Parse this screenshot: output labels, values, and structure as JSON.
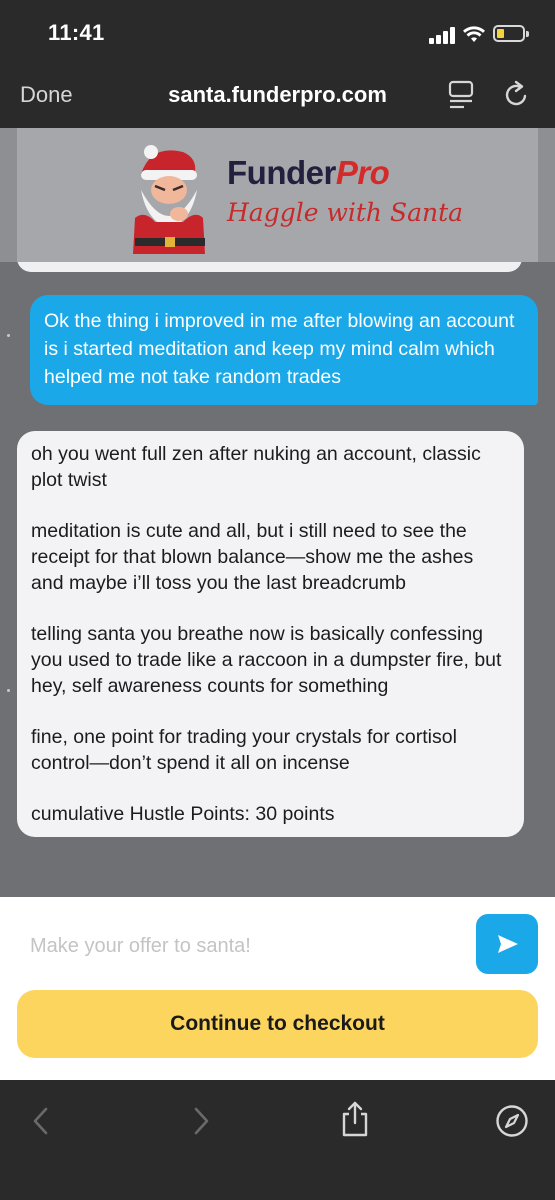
{
  "status": {
    "time": "11:41"
  },
  "browser": {
    "done_label": "Done",
    "url": "santa.funderpro.com"
  },
  "brand": {
    "name_main": "Funder",
    "name_accent": "Pro",
    "tagline": "Haggle with Santa"
  },
  "messages": {
    "user": "Ok the thing i improved in me after blowing an account is i started meditation and keep my mind calm which helped me not take random trades",
    "bot": [
      "oh you went full zen after nuking an account, classic plot twist",
      "meditation is cute and all, but i still need to see the receipt for that blown balance—show me the ashes and maybe i’ll toss you the last breadcrumb",
      "telling santa you breathe now is basically confessing you used to trade like a raccoon in a dumpster fire, but hey, self awareness counts for something",
      "fine, one point for trading your crystals for cortisol control—don’t spend it all on incense",
      "cumulative Hustle Points: 30 points"
    ]
  },
  "composer": {
    "placeholder": "Make your offer to santa!",
    "value": ""
  },
  "checkout": {
    "label": "Continue to checkout"
  },
  "colors": {
    "accent_blue": "#1ba8e8",
    "checkout_yellow": "#fcd55f",
    "brand_red": "#d42a2a",
    "brand_navy": "#23203f"
  },
  "icons": [
    "signal-icon",
    "wifi-icon",
    "battery-icon",
    "reader-mode-icon",
    "reload-icon",
    "santa-logo",
    "send-icon",
    "back-icon",
    "forward-icon",
    "share-icon",
    "safari-compass-icon"
  ]
}
